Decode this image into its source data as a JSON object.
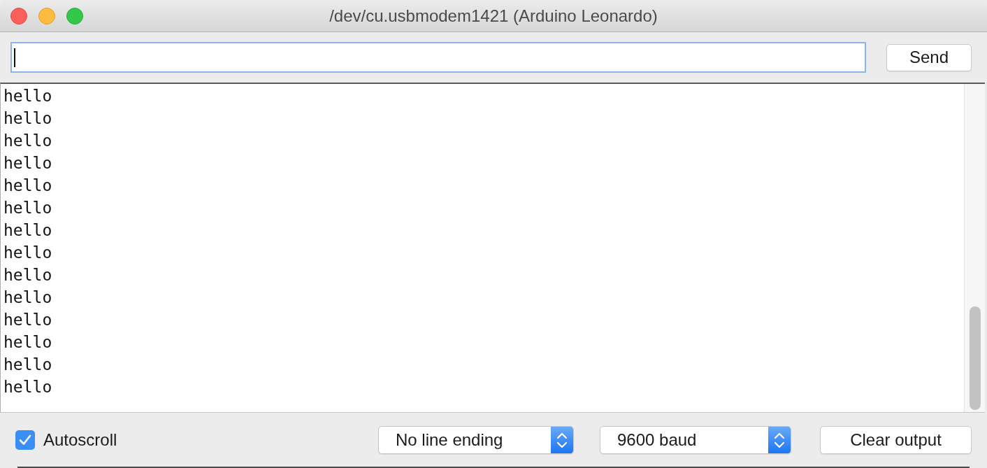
{
  "window": {
    "title": "/dev/cu.usbmodem1421 (Arduino Leonardo)"
  },
  "message_field": {
    "focused": true
  },
  "send_button": {
    "label": "Send"
  },
  "output": {
    "lines": [
      "hello",
      "hello",
      "hello",
      "hello",
      "hello",
      "hello",
      "hello",
      "hello",
      "hello",
      "hello",
      "hello",
      "hello",
      "hello",
      "hello"
    ]
  },
  "autoscroll": {
    "label": "Autoscroll",
    "checked": true
  },
  "line_ending": {
    "value": "No line ending"
  },
  "baud_rate": {
    "value": "9600 baud"
  },
  "clear_button": {
    "label": "Clear output"
  }
}
